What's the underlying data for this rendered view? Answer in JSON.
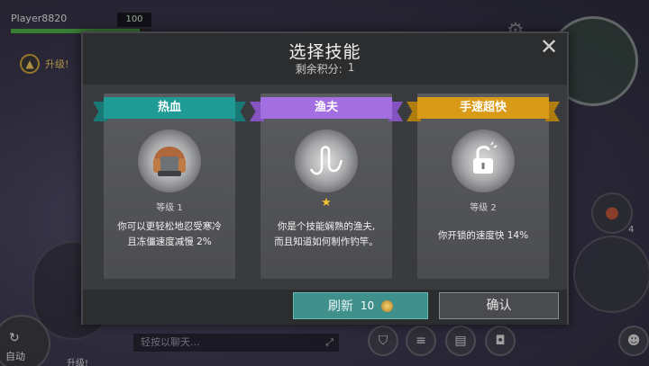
{
  "hud": {
    "player_name": "Player8820",
    "hp_value": "100",
    "hp_fraction": 0.92,
    "levelup_label": "升级!",
    "auto_label": "自动",
    "chat_placeholder": "轻按以聊天...",
    "bottom_levelup_label": "升级!",
    "meat_count": "4"
  },
  "modal": {
    "title": "选择技能",
    "points_label": "剩余积分:",
    "points_value": "1",
    "close_glyph": "✕",
    "refresh_label": "刷新",
    "refresh_cost": "10",
    "confirm_label": "确认"
  },
  "skills": [
    {
      "name": "热血",
      "banner_color": "#1f9a95",
      "banner_tail_color": "#177a76",
      "icon": "fur-hat-icon",
      "level": "等级 1",
      "desc_line1": "你可以更轻松地忍受寒冷",
      "desc_line2": "且冻僵速度减慢 2%"
    },
    {
      "name": "渔夫",
      "banner_color": "#a36ee0",
      "banner_tail_color": "#8453c0",
      "icon": "fishing-hook-icon",
      "star_count": 1,
      "desc_line1": "你是个技能娴熟的渔夫,",
      "desc_line2": "而且知道如何制作钓竿。"
    },
    {
      "name": "手速超快",
      "banner_color": "#d99a18",
      "banner_tail_color": "#b17c0f",
      "icon": "unlocked-padlock-icon",
      "level": "等级 2",
      "desc_line1": "你开锁的速度快 14%",
      "desc_line2": ""
    }
  ]
}
